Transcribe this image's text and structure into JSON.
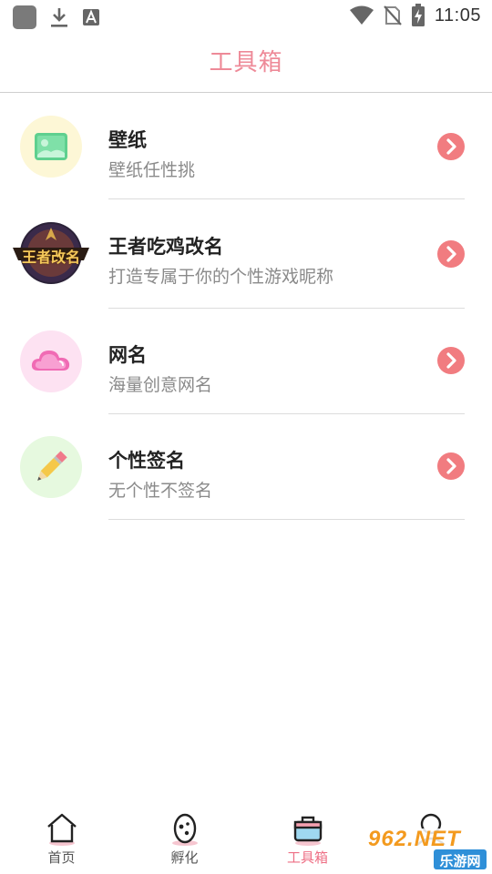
{
  "status_bar": {
    "time": "11:05",
    "icons": [
      "app-square-icon",
      "download-icon",
      "a-font-icon",
      "wifi-icon",
      "no-sim-icon",
      "battery-charging-icon"
    ]
  },
  "header": {
    "title": "工具箱"
  },
  "tools": [
    {
      "title": "壁纸",
      "subtitle": "壁纸任性挑",
      "icon": "wallpaper-icon"
    },
    {
      "title": "王者吃鸡改名",
      "subtitle": "打造专属于你的个性游戏昵称",
      "icon": "game-rename-icon",
      "icon_text": "王者改名"
    },
    {
      "title": "网名",
      "subtitle": "海量创意网名",
      "icon": "cloud-icon"
    },
    {
      "title": "个性签名",
      "subtitle": "无个性不签名",
      "icon": "pencil-icon"
    }
  ],
  "bottom_nav": {
    "items": [
      {
        "label": "首页",
        "icon": "home-icon",
        "active": false
      },
      {
        "label": "孵化",
        "icon": "egg-icon",
        "active": false
      },
      {
        "label": "工具箱",
        "icon": "toolbox-icon",
        "active": true
      },
      {
        "label": "",
        "icon": "profile-icon",
        "active": false
      }
    ]
  },
  "watermark": {
    "text_top": "962.NET",
    "text_bottom": "乐游网"
  },
  "colors": {
    "accent": "#ee8a98",
    "arrow": "#f17c80",
    "divider": "#dcdcdc",
    "subtitle": "#8a8a8a"
  }
}
